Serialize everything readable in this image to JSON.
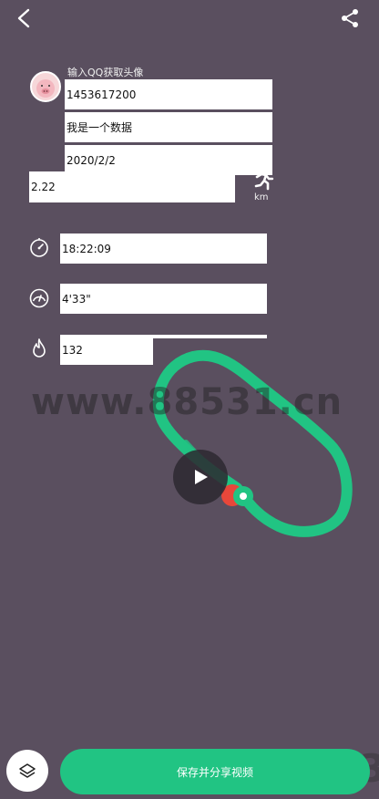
{
  "colors": {
    "background": "#5a4f5f",
    "accent": "#21c483",
    "marker_red": "#e8473a"
  },
  "header": {
    "back_icon": "chevron-left-icon",
    "share_icon": "share-icon"
  },
  "profile": {
    "avatar_caption": "输入QQ获取头像",
    "qq_number": "1453617200",
    "nickname": "我是一个数据",
    "date": "2020/2/2",
    "distance": "2.22",
    "distance_unit": "km",
    "runner_icon": "running-person-icon"
  },
  "stats": [
    {
      "icon": "stopwatch-icon",
      "value": "18:22:09"
    },
    {
      "icon": "speedometer-icon",
      "value": "4'33\""
    },
    {
      "icon": "flame-icon",
      "value": "132"
    }
  ],
  "watermark": "www.88531.cn",
  "footer": {
    "layers_icon": "layers-icon",
    "save_share_label": "保存并分享视频"
  }
}
